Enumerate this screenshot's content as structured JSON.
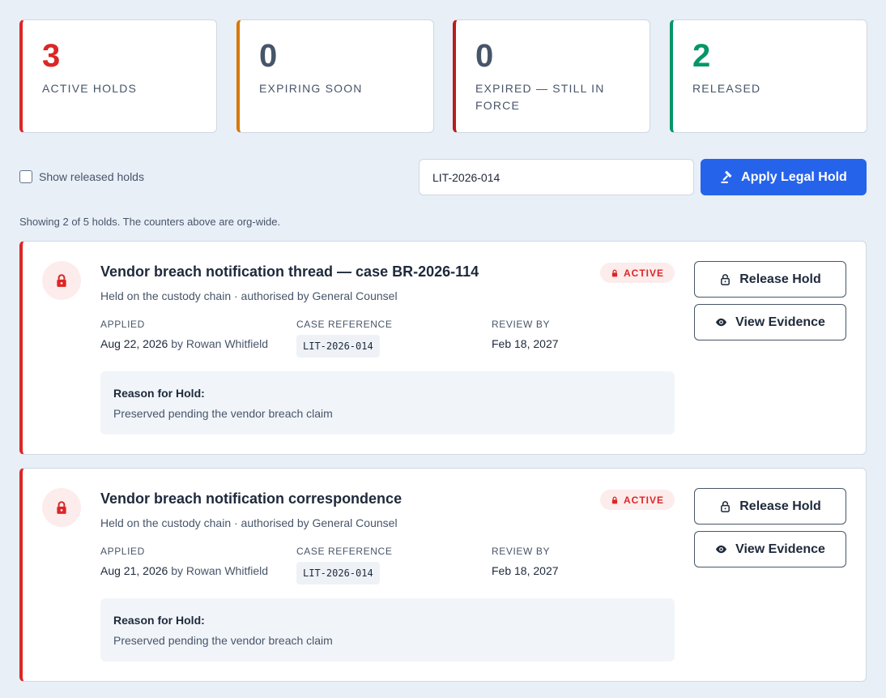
{
  "stats": [
    {
      "value": "3",
      "label": "ACTIVE HOLDS",
      "color": "#dc2626"
    },
    {
      "value": "0",
      "label": "EXPIRING SOON",
      "color": "#d97706"
    },
    {
      "value": "0",
      "label": "EXPIRED — STILL IN FORCE",
      "color": "#b91c1c"
    },
    {
      "value": "2",
      "label": "RELEASED",
      "color": "#059669"
    }
  ],
  "toolbar": {
    "show_released_label": "Show released holds",
    "show_released_checked": false,
    "case_input_value": "LIT-2026-014",
    "apply_label": "Apply Legal Hold",
    "apply_icon": "gavel-icon"
  },
  "summary": "Showing 2 of 5 holds. The counters above are org-wide.",
  "labels": {
    "applied": "APPLIED",
    "case_reference": "CASE REFERENCE",
    "review_by": "REVIEW BY",
    "reason": "Reason for Hold:",
    "release": "Release Hold",
    "view_evidence": "View Evidence"
  },
  "holds": [
    {
      "title": "Vendor breach notification thread — case BR-2026-114",
      "subtitle": "Held on the custody chain · authorised by General Counsel",
      "status": "ACTIVE",
      "applied_date": "Aug 22, 2026",
      "applied_by": "by Rowan Whitfield",
      "case_reference": "LIT-2026-014",
      "review_by": "Feb 18, 2027",
      "reason": "Preserved pending the vendor breach claim"
    },
    {
      "title": "Vendor breach notification correspondence",
      "subtitle": "Held on the custody chain · authorised by General Counsel",
      "status": "ACTIVE",
      "applied_date": "Aug 21, 2026",
      "applied_by": "by Rowan Whitfield",
      "case_reference": "LIT-2026-014",
      "review_by": "Feb 18, 2027",
      "reason": "Preserved pending the vendor breach claim"
    }
  ],
  "colors": {
    "primary": "#2563eb",
    "danger": "#dc2626",
    "warning": "#d97706",
    "success": "#059669",
    "background": "#e8eff7"
  }
}
